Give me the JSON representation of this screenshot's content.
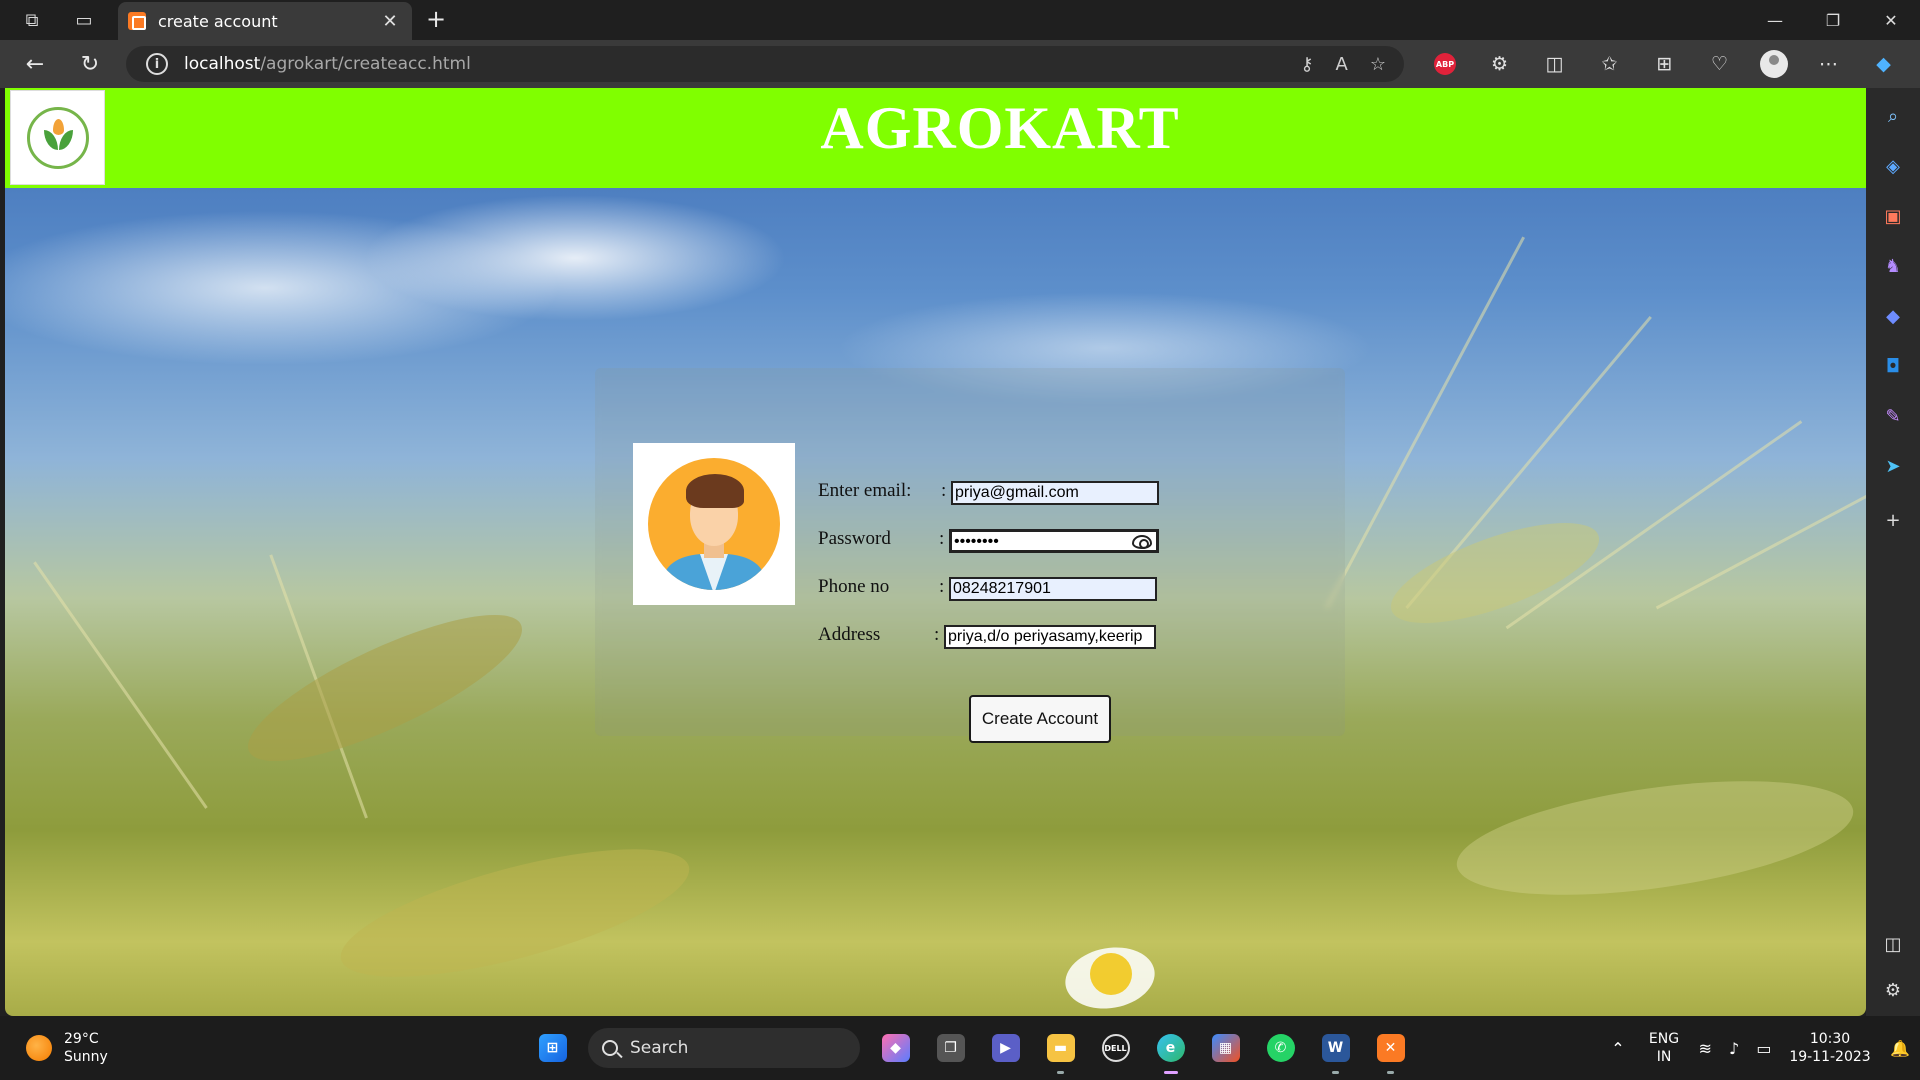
{
  "browser": {
    "tab_title": "create account",
    "url_host": "localhost",
    "url_path": "/agrokart/createacc.html",
    "icons": [
      "workspaces-icon",
      "tab-actions-icon",
      "back-icon",
      "refresh-icon",
      "site-info-icon",
      "key-icon",
      "read-aloud-icon",
      "favorite-icon",
      "adblock-icon",
      "extensions-icon",
      "split-screen-icon",
      "favorites-icon",
      "collections-icon",
      "browser-essentials-icon",
      "profile-icon",
      "more-icon",
      "copilot-icon"
    ],
    "adblock_label": "ABP"
  },
  "page": {
    "brand": "AGROKART",
    "accent_color": "#80ff00",
    "form": {
      "email_label": "Enter email:",
      "email_value": "priya@gmail.com",
      "password_label": "Password",
      "password_value": "••••••••",
      "phone_label": "Phone no",
      "phone_value": "08248217901",
      "address_label": "Address",
      "address_value": "priya,d/o periyasamy,keerip",
      "colon": ":",
      "submit_label": "Create Account"
    }
  },
  "sidebar": {
    "icons": [
      "search-icon",
      "shopping-icon",
      "tools-icon",
      "games-icon",
      "copilot-icon",
      "outlook-icon",
      "designer-icon",
      "telegram-icon",
      "add-icon",
      "hide-sidebar-icon",
      "settings-icon"
    ]
  },
  "taskbar": {
    "temperature": "29°C",
    "condition": "Sunny",
    "search_label": "Search",
    "language_1": "ENG",
    "language_2": "IN",
    "time": "10:30",
    "date": "19-11-2023"
  }
}
